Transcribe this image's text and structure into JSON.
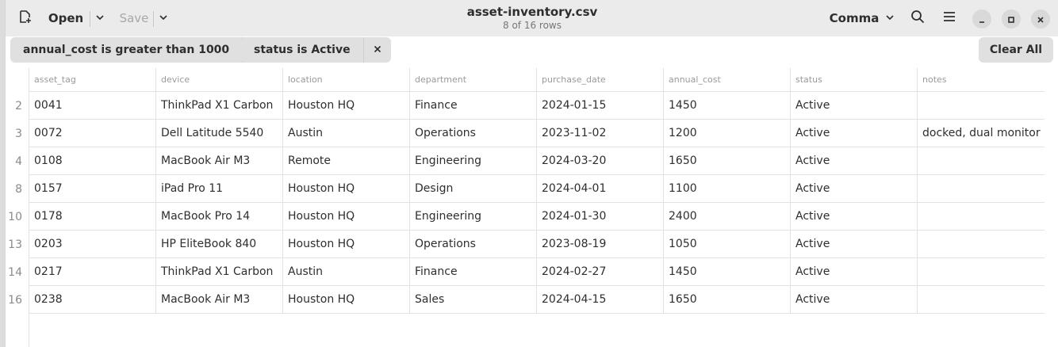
{
  "header": {
    "title": "asset-inventory.csv",
    "subtitle": "8 of 16 rows",
    "open_label": "Open",
    "save_label": "Save",
    "delimiter_label": "Comma"
  },
  "filters": [
    {
      "label": "annual_cost is greater than 1000"
    },
    {
      "label": "status is Active"
    }
  ],
  "clear_all_label": "Clear All",
  "table": {
    "columns": [
      "asset_tag",
      "device",
      "location",
      "department",
      "purchase_date",
      "annual_cost",
      "status",
      "notes"
    ],
    "rows": [
      {
        "num": "2",
        "cells": [
          "0041",
          "ThinkPad X1 Carbon",
          "Houston HQ",
          "Finance",
          "2024-01-15",
          "1450",
          "Active",
          ""
        ]
      },
      {
        "num": "3",
        "cells": [
          "0072",
          "Dell Latitude 5540",
          "Austin",
          "Operations",
          "2023-11-02",
          "1200",
          "Active",
          "docked, dual monitor"
        ]
      },
      {
        "num": "4",
        "cells": [
          "0108",
          "MacBook Air M3",
          "Remote",
          "Engineering",
          "2024-03-20",
          "1650",
          "Active",
          ""
        ]
      },
      {
        "num": "8",
        "cells": [
          "0157",
          "iPad Pro 11",
          "Houston HQ",
          "Design",
          "2024-04-01",
          "1100",
          "Active",
          ""
        ]
      },
      {
        "num": "10",
        "cells": [
          "0178",
          "MacBook Pro 14",
          "Houston HQ",
          "Engineering",
          "2024-01-30",
          "2400",
          "Active",
          ""
        ]
      },
      {
        "num": "13",
        "cells": [
          "0203",
          "HP EliteBook 840",
          "Houston HQ",
          "Operations",
          "2023-08-19",
          "1050",
          "Active",
          ""
        ]
      },
      {
        "num": "14",
        "cells": [
          "0217",
          "ThinkPad X1 Carbon",
          "Austin",
          "Finance",
          "2024-02-27",
          "1450",
          "Active",
          ""
        ]
      },
      {
        "num": "16",
        "cells": [
          "0238",
          "MacBook Air M3",
          "Houston HQ",
          "Sales",
          "2024-04-15",
          "1650",
          "Active",
          ""
        ]
      }
    ]
  },
  "icons": {
    "new": "new-document-icon",
    "dropdown": "chevron-down-icon",
    "search": "search-icon",
    "menu": "hamburger-menu-icon",
    "minimize": "minimize-icon",
    "maximize": "maximize-icon",
    "close": "close-icon",
    "remove_filter": "close-icon"
  }
}
